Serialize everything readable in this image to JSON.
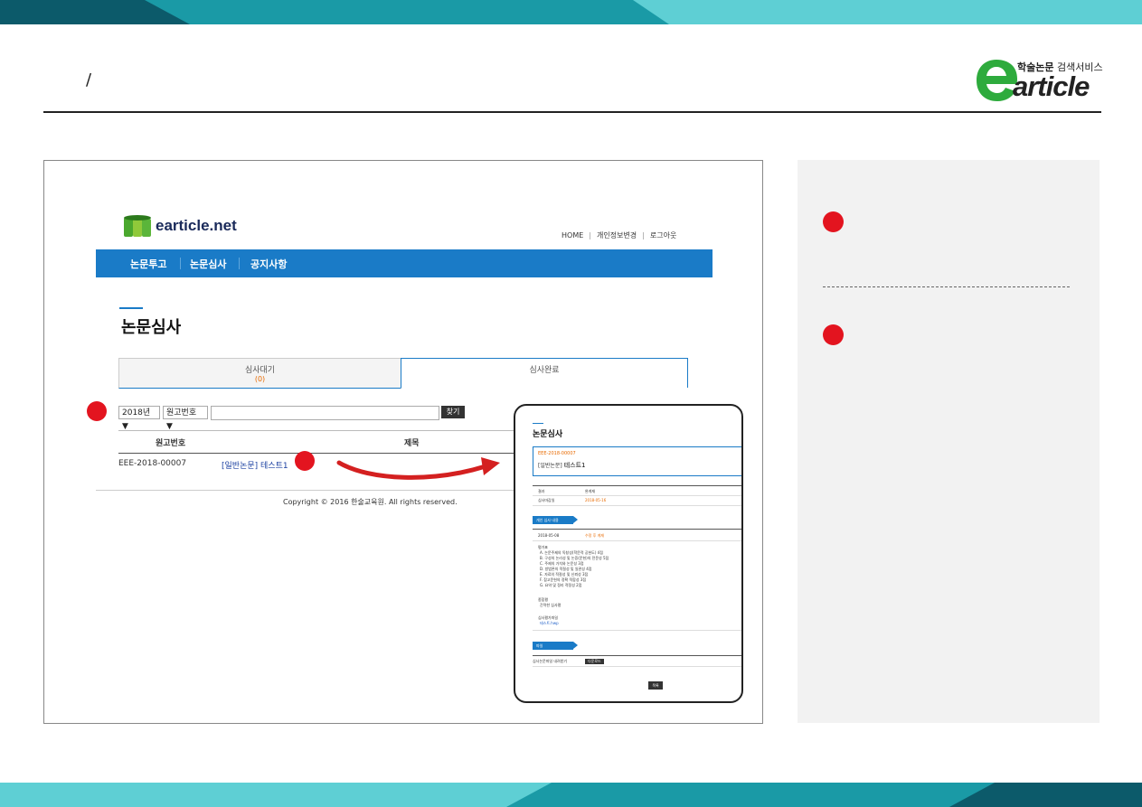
{
  "header": {
    "slash": "/",
    "brand_small_bold": "학술논문",
    "brand_small_light": " 검색서비스",
    "brand_word": "article"
  },
  "site": {
    "logo_text": "earticle.net",
    "top_links": [
      "HOME",
      "개인정보변경",
      "로그아웃"
    ],
    "nav": [
      "논문투고",
      "논문심사",
      "공지사항"
    ],
    "page_title": "논문심사",
    "tabs": [
      {
        "label": "심사대기",
        "count": "(0)"
      },
      {
        "label": "심사완료"
      }
    ],
    "search": {
      "year": "2018년 ▼",
      "field": "원고번호 ▼",
      "query": "",
      "button": "찾기"
    },
    "table": {
      "headers": [
        "원고번호",
        "제목"
      ],
      "rows": [
        {
          "id": "EEE-2018-00007",
          "category": "[일반논문]",
          "title": "테스트1"
        }
      ]
    },
    "copyright": "Copyright © 2016 한술교육원. All rights reserved."
  },
  "popup": {
    "title": "논문심사",
    "code": "EEE-2018-00007",
    "category": "[일반논문]",
    "paper_title": "테스트1",
    "rows": [
      {
        "label": "결과",
        "value": "완게재"
      },
      {
        "label": "심사마감일",
        "value": "2018-05-16"
      }
    ],
    "section1": "개인 심사 내용",
    "review_date": "2018-05-08",
    "review_result": "수정 후 게재",
    "criteria_title": "평가표",
    "criteria": [
      "A. 논문주제의 독창성(학문적 공헌도) 4점",
      "B. 구성의 논리성 및 논증(문헌)의 전문성 5점",
      "C. 주제의 가치와 논문성 3점",
      "D. 방법론의 적절성 및 일관성 4점",
      "E. 자료의 적절성 및 신뢰성 3점",
      "F. 참고문헌의 정확 적합성 3점",
      "G. 요약 및 정리 적정성 2점"
    ],
    "opinion_title": "종합평",
    "opinion": "간략한 심사평",
    "file_title": "심사평가파일",
    "file": "테스트.hwp",
    "section2": "파일",
    "file_row_label": "심사논문파일 내려받기",
    "download": "다운로드",
    "close": "목록"
  },
  "colors": {
    "accent": "#1a7bc7",
    "brand_green": "#2eab3d",
    "marker": "#e3141f",
    "arrow": "#d42020",
    "band_teal": "#5ecfd4",
    "band_dark": "#0c5a6a"
  }
}
